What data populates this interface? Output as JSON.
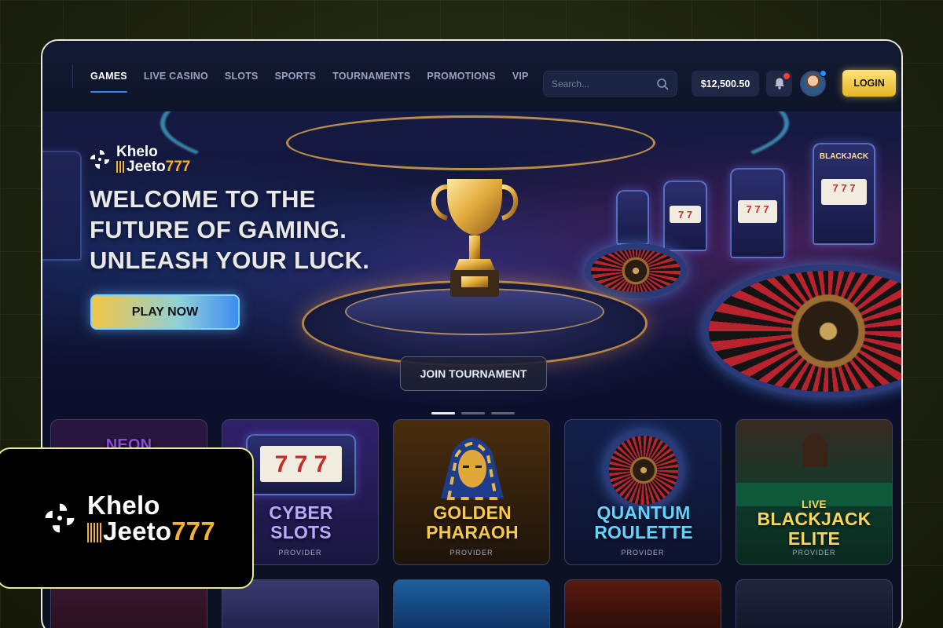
{
  "nav": {
    "items": [
      {
        "label": "GAMES",
        "active": true
      },
      {
        "label": "LIVE CASINO",
        "active": false
      },
      {
        "label": "SLOTS",
        "active": false
      },
      {
        "label": "SPORTS",
        "active": false
      },
      {
        "label": "TOURNAMENTS",
        "active": false
      },
      {
        "label": "PROMOTIONS",
        "active": false
      },
      {
        "label": "VIP",
        "active": false
      }
    ]
  },
  "header": {
    "search_placeholder": "Search...",
    "balance": "$12,500.50",
    "login_label": "LOGIN",
    "icons": {
      "search": "search-icon",
      "notifications": "bell-icon",
      "avatar": "user-avatar"
    }
  },
  "brand": {
    "line1": "Khelo",
    "line2": "Jeeto",
    "number": "777"
  },
  "hero": {
    "title_lines": [
      "WELCOME TO THE",
      "FUTURE OF GAMING.",
      "UNLEASH YOUR LUCK."
    ],
    "play_label": "PLAY NOW",
    "join_label": "JOIN TOURNAMENT",
    "slides": 3,
    "active_slide": 1,
    "slot_labels": [
      "BLACKJACK"
    ]
  },
  "games": [
    {
      "title": "NEON",
      "subtitle": ""
    },
    {
      "title": "CYBER SLOTS",
      "subtitle": "PROVIDER",
      "color": "#b9a8ff"
    },
    {
      "title": "GOLDEN PHARAOH",
      "subtitle": "PROVIDER",
      "color": "#f7c94a"
    },
    {
      "title": "QUANTUM ROULETTE",
      "subtitle": "PROVIDER",
      "color": "#63d3ff"
    },
    {
      "title": "BLACKJACK ELITE",
      "pre": "LIVE",
      "subtitle": "PROVIDER",
      "color": "#f7d45a"
    }
  ],
  "colors": {
    "accent_blue": "#2f8cff",
    "gold": "#f2b233",
    "login_gold": "#ffe37a",
    "badge_border": "#e7ed8f"
  }
}
